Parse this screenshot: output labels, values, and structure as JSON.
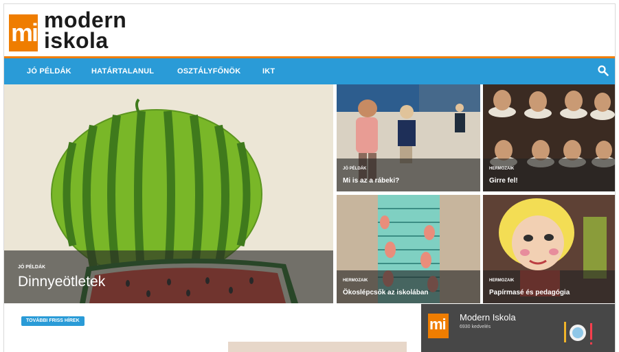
{
  "site": {
    "logo_letters": "mi",
    "logo_line1": "modern",
    "logo_line2": "iskola"
  },
  "nav": {
    "items": [
      "JÓ PÉLDÁK",
      "HATÁRTALANUL",
      "OSZTÁLYFŐNÖK",
      "IKT"
    ],
    "search_icon": "search-icon"
  },
  "hero": {
    "tag": "JÓ PÉLDÁK",
    "title": "Dinnyeötletek"
  },
  "tiles": [
    {
      "tag": "JÓ PÉLDÁK",
      "title": "Mi is az a rábeki?"
    },
    {
      "tag": "HERMOZAIK",
      "title": "Girre fel!"
    },
    {
      "tag": "HERMOZAIK",
      "title": "Ökoslépcsők az iskolában"
    },
    {
      "tag": "HERMOZAIK",
      "title": "Papírmasé és pedagógia"
    }
  ],
  "more_news_label": "TOVÁBBI FRISS HÍREK",
  "facebook": {
    "name": "Modern Iskola",
    "likes": "6930 kedvelés"
  },
  "colors": {
    "accent": "#ef7d00",
    "nav": "#2a9bd7"
  }
}
